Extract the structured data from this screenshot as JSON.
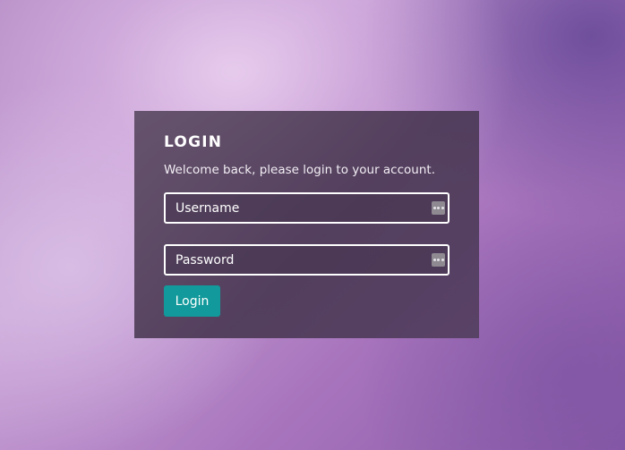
{
  "login": {
    "title": "LOGIN",
    "subtitle": "Welcome back, please login to your account.",
    "username": {
      "placeholder": "Username",
      "value": "",
      "icon": "password-manager-dots-icon"
    },
    "password": {
      "placeholder": "Password",
      "value": "",
      "icon": "password-manager-dots-icon"
    },
    "button_label": "Login"
  },
  "colors": {
    "button": "#12999b",
    "panel": "#4f3d5a",
    "background_light": "#d6b4e0",
    "background_dark": "#7a4e9e"
  }
}
